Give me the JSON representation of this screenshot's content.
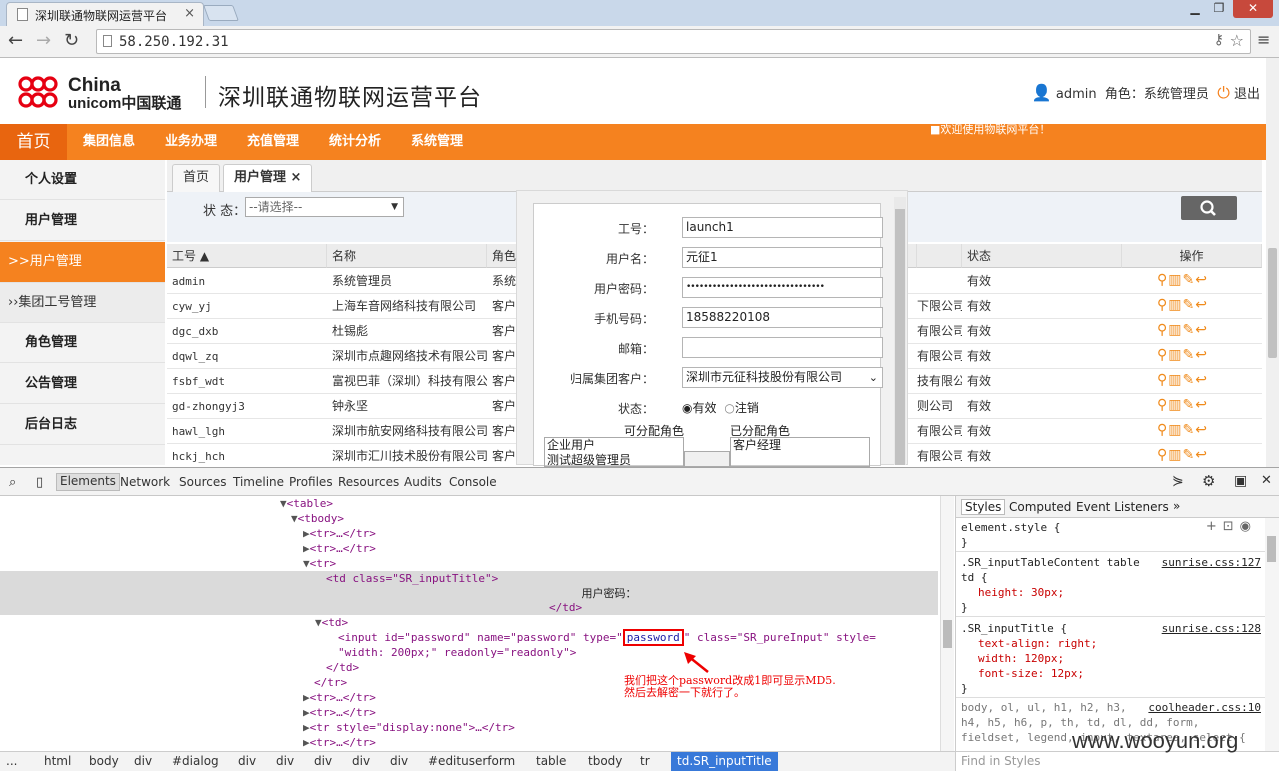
{
  "browser": {
    "tab_title": "深圳联通物联网运营平台",
    "url": "58.250.192.31"
  },
  "header": {
    "logo_line1": "China",
    "logo_line2": "unicom中国联通",
    "site_title": "深圳联通物联网运营平台",
    "username": "admin",
    "role_label": "角色：系统管理员",
    "logout": "退出"
  },
  "mainnav": {
    "home": "首页",
    "items": [
      "集团信息",
      "业务办理",
      "充值管理",
      "统计分析",
      "系统管理"
    ],
    "welcome": "■欢迎使用物联网平台！"
  },
  "sidebar": {
    "items": [
      "个人设置",
      "用户管理",
      ">>用户管理",
      "››集团工号管理",
      "角色管理",
      "公告管理",
      "后台日志"
    ]
  },
  "content": {
    "tabs": [
      "首页",
      "用户管理 ×"
    ],
    "filter_label": "状  态：",
    "filter_value": "--请选择--",
    "columns": [
      "工号 ▲",
      "名称",
      "角色",
      "状态",
      "操作"
    ],
    "rows": [
      {
        "id": "admin",
        "name": "系统管理员",
        "role": "系统",
        "mid": "",
        "status": "有效"
      },
      {
        "id": "cyw_yj",
        "name": "上海车音网络科技有限公司",
        "role": "客户",
        "mid": "下限公司",
        "status": "有效"
      },
      {
        "id": "dgc_dxb",
        "name": "杜锡彪",
        "role": "客户",
        "mid": "有限公司",
        "status": "有效"
      },
      {
        "id": "dqwl_zq",
        "name": "深圳市点趣网络技术有限公司",
        "role": "客户",
        "mid": "有限公司",
        "status": "有效"
      },
      {
        "id": "fsbf_wdt",
        "name": "富视巴菲（深圳）科技有限公",
        "role": "客户",
        "mid": "技有限公",
        "status": "有效"
      },
      {
        "id": "gd-zhongyj3",
        "name": "钟永坚",
        "role": "客户",
        "mid": "则公司",
        "status": "有效"
      },
      {
        "id": "hawl_lgh",
        "name": "深圳市航安网络科技有限公司",
        "role": "客户",
        "mid": "有限公司",
        "status": "有效"
      },
      {
        "id": "hckj_hch",
        "name": "深圳市汇川技术股份有限公司",
        "role": "客户",
        "mid": "有限公司",
        "status": "有效"
      }
    ]
  },
  "dialog": {
    "fields": [
      {
        "label": "工号：",
        "value": "launch1"
      },
      {
        "label": "用户名：",
        "value": "元征1"
      },
      {
        "label": "用户密码：",
        "value": "••••••••••••••••••••••••••••••••"
      },
      {
        "label": "手机号码：",
        "value": "18588220108"
      },
      {
        "label": "邮箱：",
        "value": ""
      },
      {
        "label": "归属集团客户：",
        "value": "深圳市元征科技股份有限公司"
      }
    ],
    "status_label": "状态：",
    "status_valid": "有效",
    "status_cancel": "注销",
    "available_roles_label": "可分配角色",
    "assigned_roles_label": "已分配角色",
    "available_roles": [
      "企业用户",
      "测试超级管理员"
    ],
    "assigned_roles": [
      "客户经理"
    ]
  },
  "devtools": {
    "tabs": [
      "Elements",
      "Network",
      "Sources",
      "Timeline",
      "Profiles",
      "Resources",
      "Audits",
      "Console"
    ],
    "lines": [
      "<table>",
      "<tbody>",
      "<tr>…</tr>",
      "<tr>…</tr>",
      "<tr>",
      "<td class=\"SR_inputTitle\">",
      "用户密码：",
      "</td>",
      "<td>",
      "<input id=\"password\" name=\"password\" type=\"",
      "password",
      "\" class=\"SR_pureInput\" style=",
      "\"width: 200px;\" readonly=\"readonly\">",
      "</td>",
      "</tr>",
      "<tr>…</tr>",
      "<tr>…</tr>",
      "<tr style=\"display:none\">…</tr>",
      "<tr>…</tr>"
    ],
    "annotation_line1": "我们把这个password改成1即可显示MD5.",
    "annotation_line2": "然后去解密一下就行了。",
    "styles_tabs": [
      "Styles",
      "Computed",
      "Event Listeners",
      "»"
    ],
    "styles": {
      "r1": "element.style {",
      "r1end": "}",
      "r2sel": ".SR_inputTableContent table",
      "r2sel2": "td {",
      "r2link": "sunrise.css:127",
      "r2p1": "height: 30px;",
      "r3sel": ".SR_inputTitle {",
      "r3link": "sunrise.css:128",
      "r3p1": "text-align: right;",
      "r3p2": "width: 120px;",
      "r3p3": "font-size: 12px;",
      "r4sel": "body, ol, ul, h1, h2, h3,",
      "r4link": "coolheader.css:10",
      "r4sel2": "h4, h5, h6, p, th, td, dl, dd, form,",
      "r4sel3": "fieldset, legend, input, textarea, select {"
    },
    "breadcrumbs": [
      "...",
      "html",
      "body",
      "div",
      "#dialog",
      "div",
      "div",
      "div",
      "div",
      "div",
      "#edituserform",
      "table",
      "tbody",
      "tr",
      "td.SR_inputTitle"
    ],
    "find_placeholder": "Find in Styles"
  },
  "watermark": "www.wooyun.org"
}
